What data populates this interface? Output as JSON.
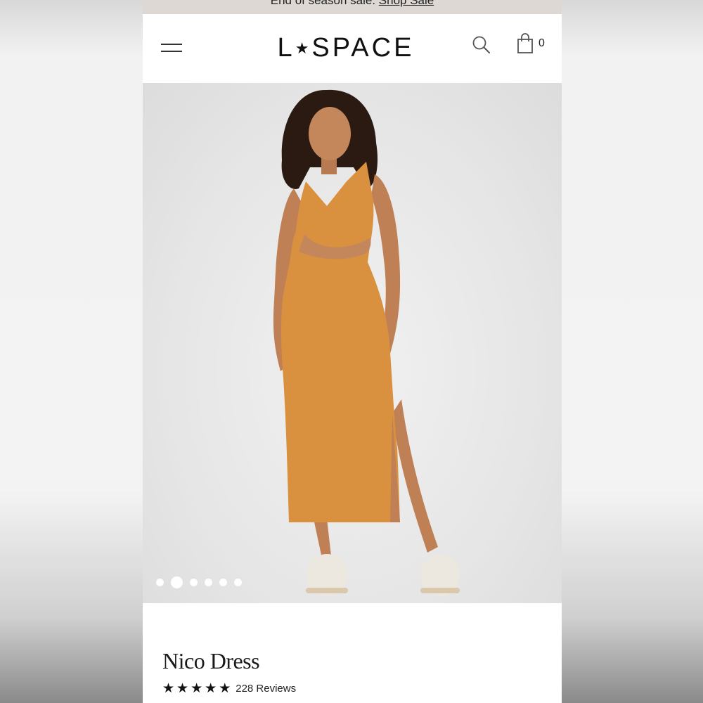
{
  "promo": {
    "text": "End of season sale.",
    "link_label": "Shop Sale"
  },
  "header": {
    "logo_left": "L",
    "logo_star": "★",
    "logo_right": "SPACE",
    "menu_icon": "hamburger-menu-icon",
    "search_icon": "search-icon",
    "bag_icon": "shopping-bag-icon",
    "bag_count": "0"
  },
  "gallery": {
    "image_count": 6,
    "active_index": 1
  },
  "product": {
    "name": "Nico Dress",
    "rating_stars": 5,
    "reviews_label": "228 Reviews"
  },
  "colors": {
    "banner_bg": "#ddd8d3",
    "dress": "#d9913f",
    "image_bg": "#e8e8e8"
  }
}
